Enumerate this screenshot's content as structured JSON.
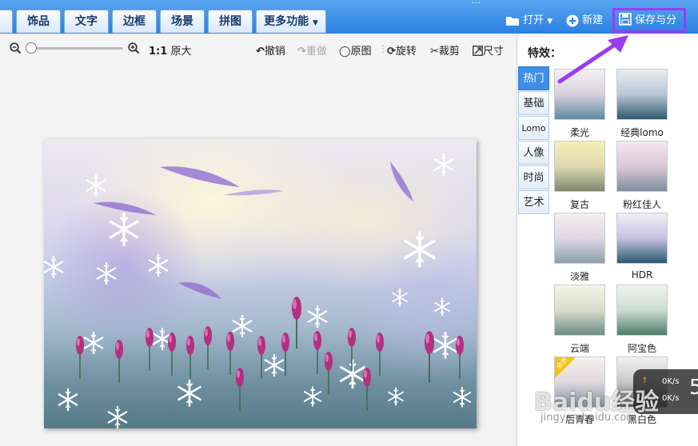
{
  "toolbar": {
    "tabs": [
      "饰品",
      "文字",
      "边框",
      "场景",
      "拼图",
      "更多功能"
    ],
    "open_label": "打开",
    "new_label": "新建",
    "save_share_label": "保存与分享"
  },
  "tools": {
    "zoom_ratio": "1:1",
    "original_size": "原大",
    "undo": "撤销",
    "redo": "重做",
    "original": "原图",
    "rotate": "旋转",
    "crop": "裁剪",
    "size": "尺寸"
  },
  "effects_panel": {
    "title": "特效：",
    "categories": [
      "热门",
      "基础",
      "Lomo",
      "人像",
      "时尚",
      "艺术"
    ],
    "active_category": "热门",
    "items": [
      "柔光",
      "经典lomo",
      "复古",
      "粉红佳人",
      "淡雅",
      "HDR",
      "云端",
      "阿宝色",
      "后青春",
      "黑白色"
    ],
    "vip_badge": "会员"
  },
  "network_speed": {
    "up": "0K/s",
    "down": "0K/s"
  },
  "watermark": {
    "logo": "Baidu经验",
    "url": "jingyan.baidu.com"
  },
  "colors": {
    "accent_purple": "#9b3cf0",
    "toolbar_blue": "#2b7fe0",
    "active_tab": "#3f8fe6"
  }
}
